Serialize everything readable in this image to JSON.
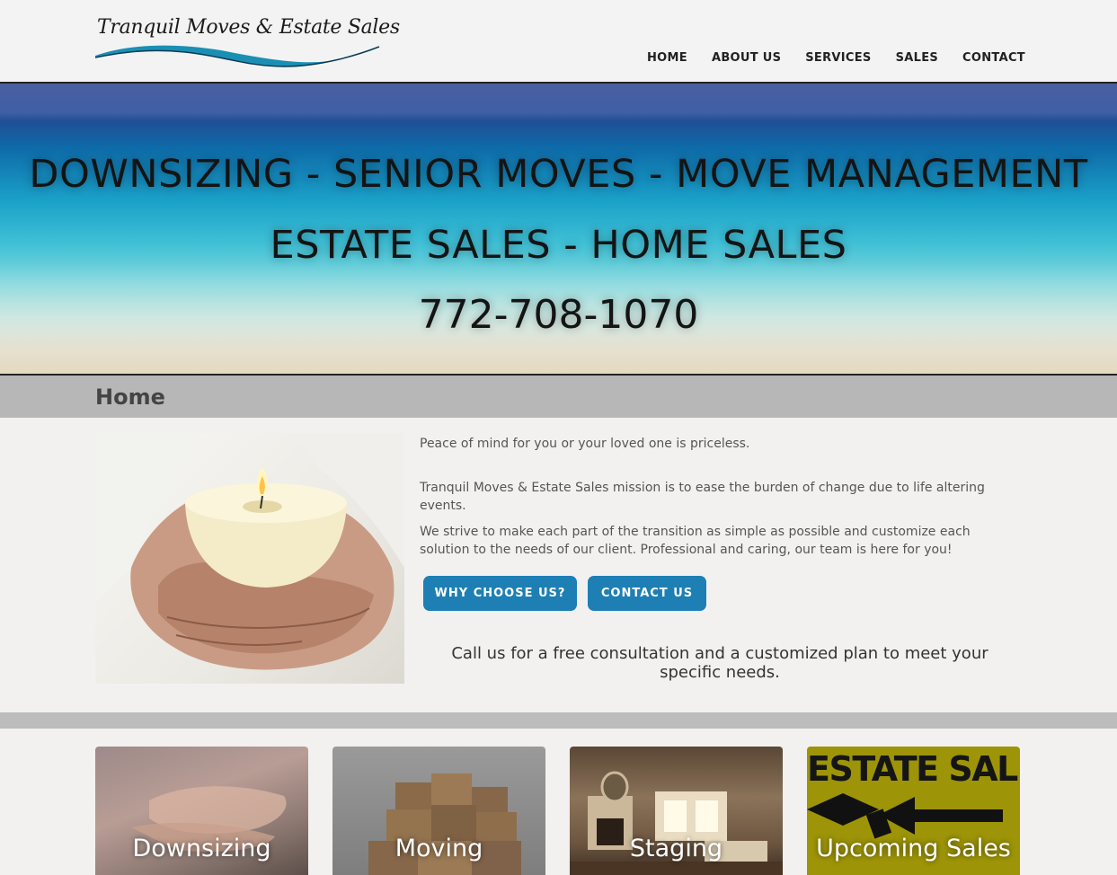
{
  "site": {
    "logo_text": "Tranquil Moves & Estate Sales"
  },
  "nav": {
    "items": [
      "HOME",
      "ABOUT US",
      "SERVICES",
      "SALES",
      "CONTACT"
    ]
  },
  "hero": {
    "line1": "DOWNSIZING - SENIOR MOVES - MOVE MANAGEMENT",
    "line2": "ESTATE SALES - HOME SALES",
    "phone": "772-708-1070"
  },
  "page": {
    "title": "Home"
  },
  "main": {
    "p1": "Peace of mind for you or your loved one is priceless.",
    "p2": "Tranquil Moves & Estate Sales mission is to ease the burden of change due to life altering events.",
    "p3": "We strive to make each part of the transition as simple as possible and customize each solution to the needs of our client. Professional and caring, our team is here for you!",
    "btn_why": "WHY CHOOSE US?",
    "btn_contact": "CONTACT US",
    "callout": "Call us for a free consultation and a customized plan to meet your specific needs."
  },
  "tiles": [
    {
      "label": "Downsizing"
    },
    {
      "label": "Moving"
    },
    {
      "label": "Staging"
    },
    {
      "label": "Upcoming Sales",
      "banner": "ESTATE SALE"
    }
  ],
  "colors": {
    "accent": "#1d7fb4",
    "titlebar": "#b7b7b7",
    "logo_wave": "#1b8fb3"
  }
}
